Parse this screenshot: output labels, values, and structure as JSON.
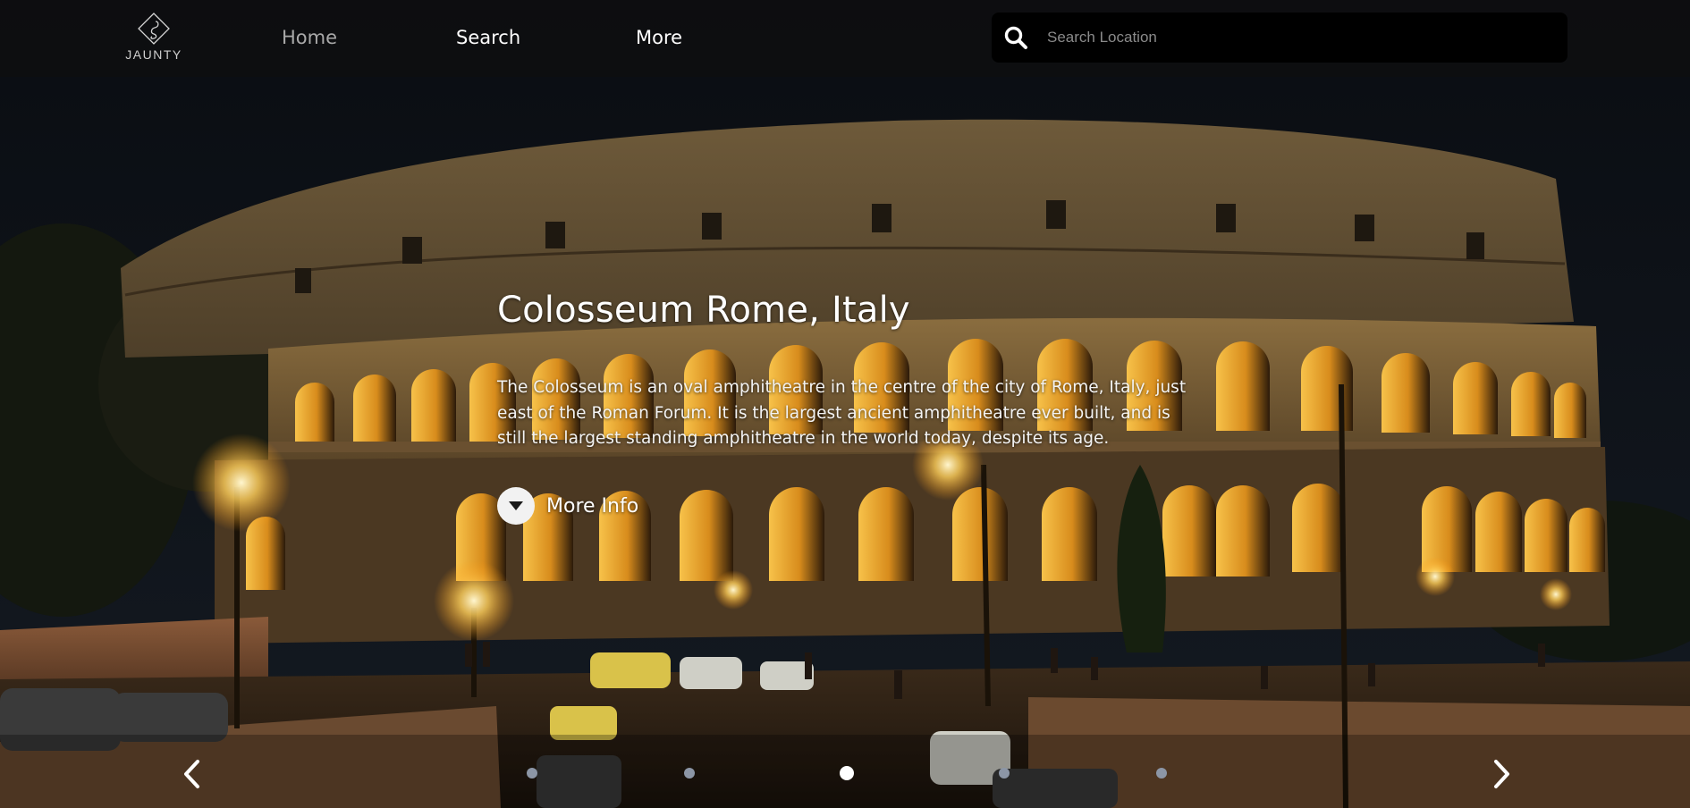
{
  "brand": {
    "name": "JAUNTY",
    "logo_icon": "jaunty-diamond-logo"
  },
  "nav": {
    "items": [
      {
        "label": "Home",
        "active": true
      },
      {
        "label": "Search",
        "active": false
      },
      {
        "label": "More",
        "active": false
      }
    ]
  },
  "search": {
    "placeholder": "Search Location",
    "value": "",
    "icon": "search-icon"
  },
  "hero": {
    "title": "Colosseum Rome, Italy",
    "description": "The Colosseum is an oval amphitheatre in the centre of the city of Rome, Italy, just east of the Roman Forum. It is the largest ancient amphitheatre ever built, and is still the largest standing amphitheatre in the world today, despite its age.",
    "more_info_label": "More Info",
    "more_info_icon": "chevron-down-icon"
  },
  "carousel": {
    "prev_icon": "chevron-left-icon",
    "next_icon": "chevron-right-icon",
    "slide_count": 5,
    "active_slide": 3
  },
  "colors": {
    "navbar_bg": "#0e0e10",
    "search_bg": "#000000",
    "nav_inactive": "#a9a9a9",
    "dot_inactive": "#8c96a6",
    "dot_active": "#ffffff",
    "stone_lit": "#e8a629",
    "night_sky": "#0d1118"
  }
}
